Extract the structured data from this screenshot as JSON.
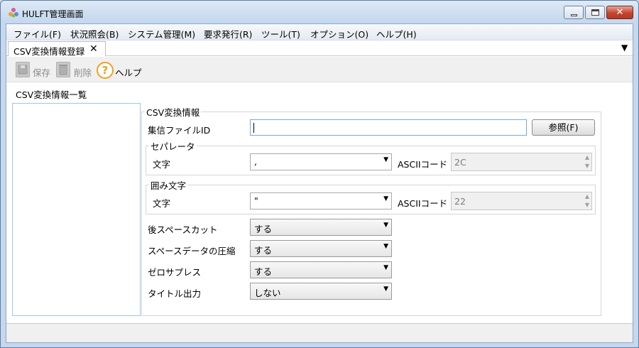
{
  "window": {
    "title": "HULFT管理画面",
    "close_glyph": "✕"
  },
  "menu": [
    "ファイル(F)",
    "状況照会(B)",
    "システム管理(M)",
    "要求発行(R)",
    "ツール(T)",
    "オプション(O)",
    "ヘルプ(H)"
  ],
  "tab": {
    "label": "CSV変換情報登録",
    "close": "✕",
    "menu_glyph": "▼"
  },
  "toolbar": {
    "save": "保存",
    "delete": "削除",
    "help": "ヘルプ",
    "help_glyph": "?"
  },
  "list": {
    "title": "CSV変換情報一覧"
  },
  "form": {
    "group_title": "CSV変換情報",
    "file_id_label": "集信ファイルID",
    "file_id_value": "",
    "browse_button": "参照(F)",
    "separator": {
      "title": "セパレータ",
      "char_label": "文字",
      "char_value": ",",
      "ascii_label": "ASCIIコード",
      "ascii_value": "2C"
    },
    "enclosure": {
      "title": "囲み文字",
      "char_label": "文字",
      "char_value": "\"",
      "ascii_label": "ASCIIコード",
      "ascii_value": "22"
    },
    "trailing_space_cut": {
      "label": "後スペースカット",
      "value": "する"
    },
    "space_compress": {
      "label": "スペースデータの圧縮",
      "value": "する"
    },
    "zero_suppress": {
      "label": "ゼロサプレス",
      "value": "する"
    },
    "title_output": {
      "label": "タイトル出力",
      "value": "しない"
    }
  },
  "glyphs": {
    "dropdown": "▼",
    "spin_up": "▲",
    "spin_down": "▼"
  }
}
